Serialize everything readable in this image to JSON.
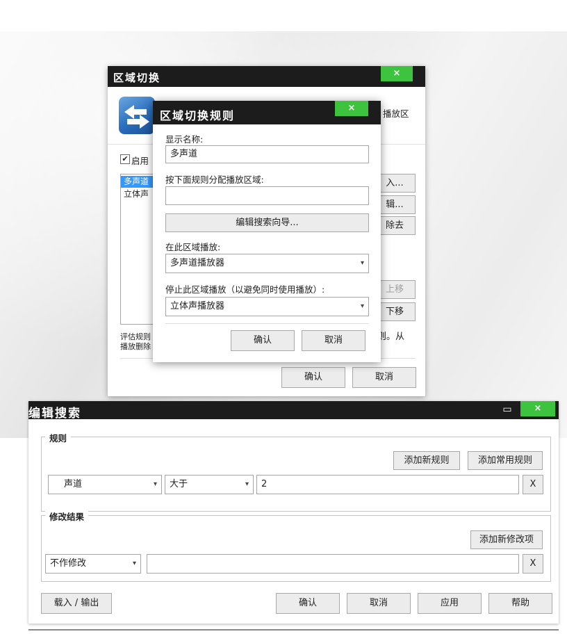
{
  "zone_switch": {
    "title": "区域切换",
    "header_desc": "播放区",
    "enable_label": "启用",
    "list_items": [
      "多声道",
      "立体声"
    ],
    "side_buttons": [
      "入...",
      "辑...",
      "除去"
    ],
    "move_buttons": [
      "上移",
      "下移"
    ],
    "footer_text_1": "评估规则",
    "footer_text_2": "播放删除",
    "footer_text_right": "则。从",
    "ok_label": "确认",
    "cancel_label": "取消",
    "close_glyph": "×"
  },
  "zone_rule": {
    "title": "区域切换规则",
    "display_name_label": "显示名称:",
    "display_name_value": "多声道",
    "assign_rule_label": "按下面规则分配播放区域:",
    "assign_rule_value": "",
    "edit_wizard_button": "编辑搜索向导...",
    "play_here_label": "在此区域播放:",
    "play_here_value": "多声道播放器",
    "stop_here_label": "停止此区域播放（以避免同时使用播放）:",
    "stop_here_value": "立体声播放器",
    "ok_label": "确认",
    "cancel_label": "取消",
    "close_glyph": "×"
  },
  "edit_search": {
    "title": "编辑搜索",
    "maximize_glyph": "▭",
    "close_glyph": "×",
    "rules_group": "规则",
    "add_new_rule": "添加新规则",
    "add_common_rule": "添加常用规则",
    "rule_field_value": "声道",
    "rule_operator_value": "大于",
    "rule_value": "2",
    "remove_glyph": "X",
    "modify_group": "修改结果",
    "add_modify_item": "添加新修改项",
    "modify_action_value": "不作修改",
    "modify_value": "",
    "load_export": "载入 / 输出",
    "ok_label": "确认",
    "cancel_label": "取消",
    "apply_label": "应用",
    "help_label": "帮助"
  },
  "colors": {
    "titlebar": "#1c1c1c",
    "close_green": "#3ec33e",
    "list_selection": "#3399ff"
  }
}
